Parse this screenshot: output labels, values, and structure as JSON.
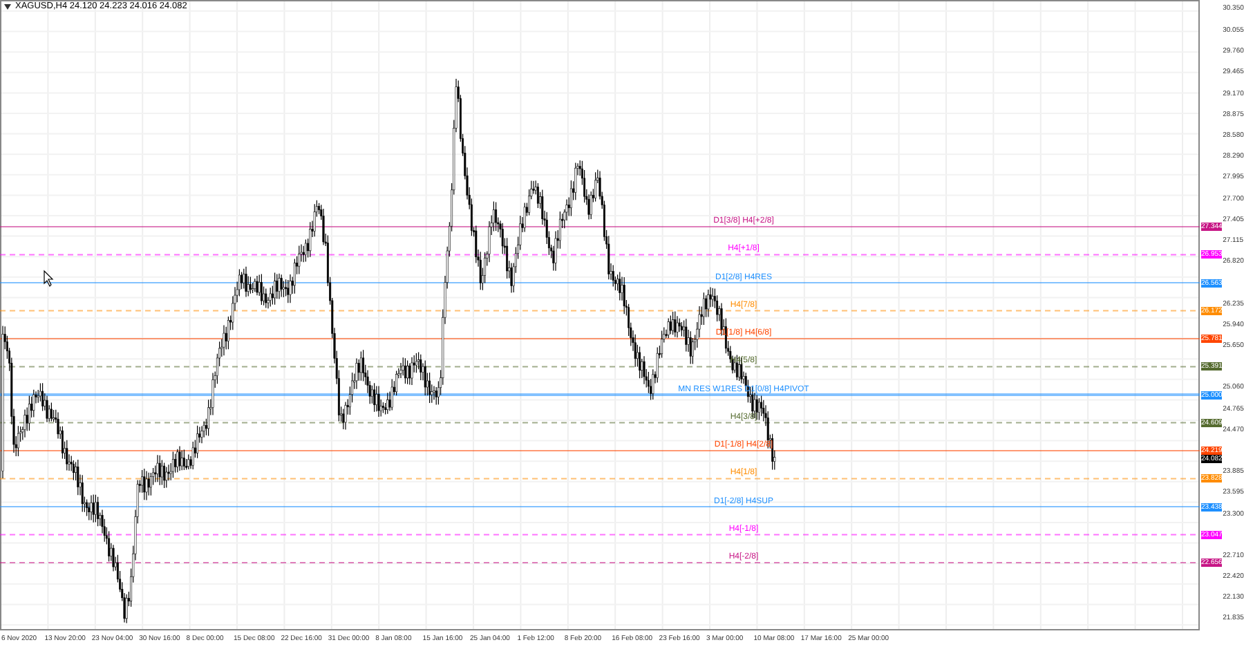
{
  "chart_header": {
    "title": "XAGUSD,H4 24.120 24.223 24.016 24.082"
  },
  "price_axis": {
    "ticks": [
      "30.350",
      "30.055",
      "29.760",
      "29.465",
      "29.170",
      "28.875",
      "28.580",
      "28.290",
      "27.995",
      "27.700",
      "27.405",
      "27.115",
      "26.820",
      "26.235",
      "25.940",
      "25.650",
      "25.060",
      "24.765",
      "24.470",
      "23.885",
      "23.595",
      "23.300",
      "22.710",
      "22.420",
      "22.130",
      "21.835"
    ]
  },
  "levels": [
    {
      "label": "D1[3/8] H4[+2/8]",
      "tag": "27.344",
      "color": "#c71585",
      "kind": "solid"
    },
    {
      "label": "H4[+1/8]",
      "tag": "26.953",
      "color": "#ff00ff",
      "kind": "dashed"
    },
    {
      "label": "D1[2/8] H4RES",
      "tag": "26.563",
      "color": "#1e90ff",
      "kind": "solid"
    },
    {
      "label": "H4[7/8]",
      "tag": "26.172",
      "color": "#ff8c00",
      "kind": "dashed"
    },
    {
      "label": "D1[1/8] H4[6/8]",
      "tag": "25.781",
      "color": "#ff4500",
      "kind": "solid"
    },
    {
      "label": "H4[5/8]",
      "tag": "25.391",
      "color": "#556b2f",
      "kind": "dashed"
    },
    {
      "label": "MN RES W1RES D1[0/8] H4PIVOT",
      "tag": "25.000",
      "color": "#1e90ff",
      "kind": "thick"
    },
    {
      "label": "H4[3/8]",
      "tag": "24.609",
      "color": "#556b2f",
      "kind": "dashed"
    },
    {
      "label": "D1[-1/8] H4[2/8]",
      "tag": "24.219",
      "color": "#ff4500",
      "kind": "solid"
    },
    {
      "label": "H4[1/8]",
      "tag": "23.828",
      "color": "#ff8c00",
      "kind": "dashed"
    },
    {
      "label": "D1[-2/8] H4SUP",
      "tag": "23.438",
      "color": "#1e90ff",
      "kind": "solid"
    },
    {
      "label": "H4[-1/8]",
      "tag": "23.047",
      "color": "#ff00ff",
      "kind": "dashed"
    },
    {
      "label": "H4[-2/8]",
      "tag": "22.656",
      "color": "#c71585",
      "kind": "dashed"
    }
  ],
  "current_price": {
    "tag": "24.082"
  },
  "time_axis": {
    "ticks": [
      "6 Nov 2020",
      "13 Nov 20:00",
      "23 Nov 04:00",
      "30 Nov 16:00",
      "8 Dec 00:00",
      "15 Dec 08:00",
      "22 Dec 16:00",
      "31 Dec 00:00",
      "8 Jan 08:00",
      "15 Jan 16:00",
      "25 Jan 04:00",
      "1 Feb 12:00",
      "8 Feb 20:00",
      "16 Feb 08:00",
      "23 Feb 16:00",
      "3 Mar 00:00",
      "10 Mar 08:00",
      "17 Mar 16:00",
      "25 Mar 00:00"
    ]
  }
}
